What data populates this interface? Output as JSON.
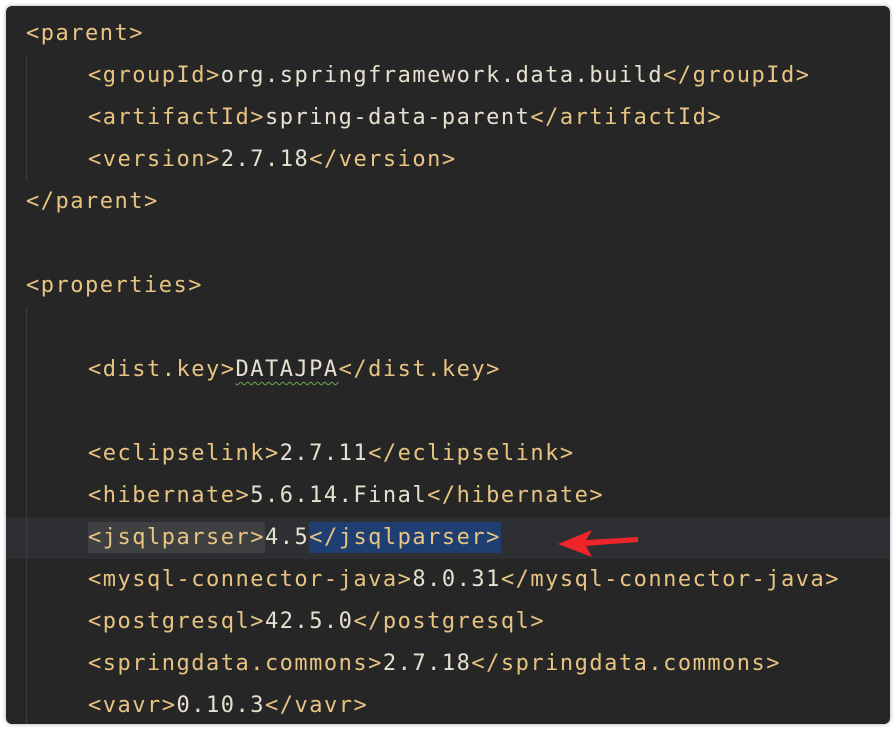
{
  "editor": {
    "lines": [
      {
        "indent": 0,
        "open": "<parent>",
        "text": "",
        "close": ""
      },
      {
        "indent": 1,
        "open": "<groupId>",
        "text": "org.springframework.data.build",
        "close": "</groupId>"
      },
      {
        "indent": 1,
        "open": "<artifactId>",
        "text": "spring-data-parent",
        "close": "</artifactId>"
      },
      {
        "indent": 1,
        "open": "<version>",
        "text": "2.7.18",
        "close": "</version>"
      },
      {
        "indent": 0,
        "open": "</parent>",
        "text": "",
        "close": ""
      },
      {
        "indent": 0,
        "open": "",
        "text": "",
        "close": ""
      },
      {
        "indent": 0,
        "open": "<properties>",
        "text": "",
        "close": ""
      },
      {
        "indent": 0,
        "open": "",
        "text": "",
        "close": ""
      },
      {
        "indent": 1,
        "open": "<dist.key>",
        "text": "DATAJPA",
        "close": "</dist.key>"
      },
      {
        "indent": 0,
        "open": "",
        "text": "",
        "close": ""
      },
      {
        "indent": 1,
        "open": "<eclipselink>",
        "text": "2.7.11",
        "close": "</eclipselink>"
      },
      {
        "indent": 1,
        "open": "<hibernate>",
        "text": "5.6.14.Final",
        "close": "</hibernate>"
      },
      {
        "indent": 1,
        "open": "<jsqlparser>",
        "text": "4.5",
        "close": "</jsqlparser>"
      },
      {
        "indent": 1,
        "open": "<mysql-connector-java>",
        "text": "8.0.31",
        "close": "</mysql-connector-java>"
      },
      {
        "indent": 1,
        "open": "<postgresql>",
        "text": "42.5.0",
        "close": "</postgresql>"
      },
      {
        "indent": 1,
        "open": "<springdata.commons>",
        "text": "2.7.18",
        "close": "</springdata.commons>"
      },
      {
        "indent": 1,
        "open": "<vavr>",
        "text": "0.10.3",
        "close": "</vavr>"
      }
    ]
  },
  "colors": {
    "background": "#262626",
    "tag": "#e8c482",
    "text": "#e6e0d0",
    "selection": "#1f3f73",
    "match_highlight": "#3e4042",
    "arrow": "#f0252b"
  },
  "annotation": {
    "icon": "red-arrow-icon"
  }
}
